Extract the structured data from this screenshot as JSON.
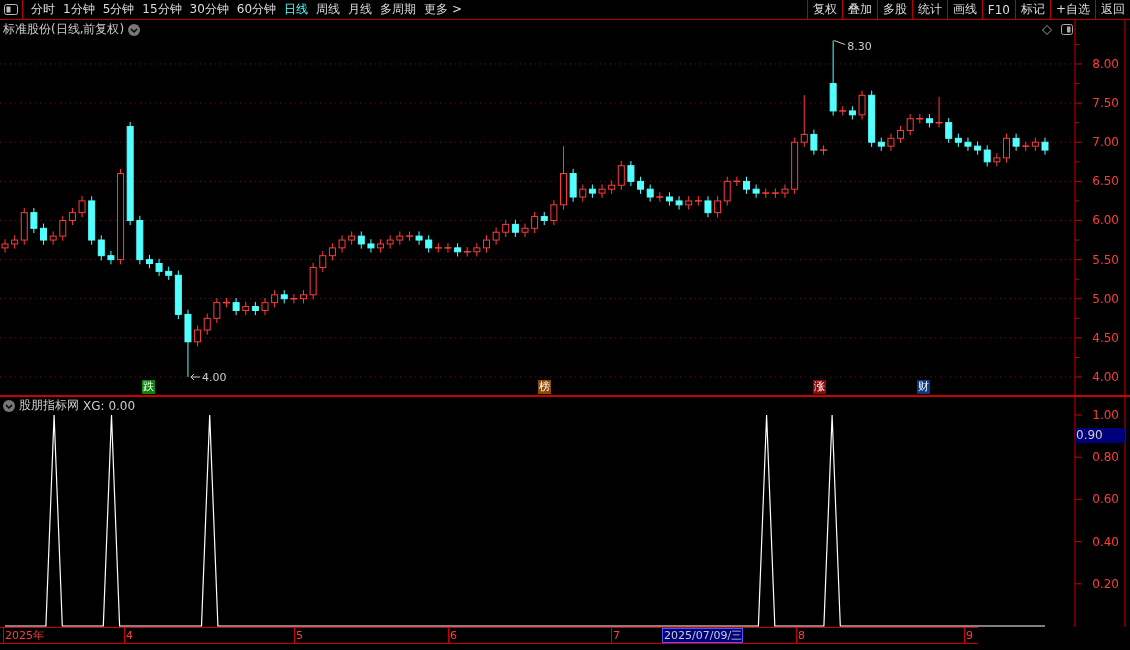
{
  "toolbar": {
    "periods": [
      {
        "label": "分时",
        "selected": false
      },
      {
        "label": "1分钟",
        "selected": false
      },
      {
        "label": "5分钟",
        "selected": false
      },
      {
        "label": "15分钟",
        "selected": false
      },
      {
        "label": "30分钟",
        "selected": false
      },
      {
        "label": "60分钟",
        "selected": false
      },
      {
        "label": "日线",
        "selected": true
      },
      {
        "label": "周线",
        "selected": false
      },
      {
        "label": "月线",
        "selected": false
      },
      {
        "label": "多周期",
        "selected": false
      },
      {
        "label": "更多 >",
        "selected": false
      }
    ],
    "buttons": [
      "复权",
      "叠加",
      "多股",
      "统计",
      "画线",
      "F10",
      "标记",
      "+自选",
      "返回"
    ]
  },
  "main_chart": {
    "title": "标准股份(日线,前复权)",
    "high_label": "8.30",
    "low_label": "4.00",
    "tags": [
      {
        "label": "跌",
        "color": "#0a860a"
      },
      {
        "label": "榜",
        "color": "#8c4a0a"
      },
      {
        "label": "涨",
        "color": "#8a0a0a"
      },
      {
        "label": "财",
        "color": "#0c3a80"
      }
    ],
    "chart_data": {
      "type": "candlestick",
      "ylim": [
        3.757,
        8.562
      ],
      "yticks": [
        {
          "value": 8,
          "label": "8.00"
        },
        {
          "value": 7.5,
          "label": "7.50"
        },
        {
          "value": 7,
          "label": "7.00"
        },
        {
          "value": 6.5,
          "label": "6.50"
        },
        {
          "value": 6,
          "label": "6.00"
        },
        {
          "value": 5.5,
          "label": "5.50"
        },
        {
          "value": 5,
          "label": "5.00"
        },
        {
          "value": 4.5,
          "label": "4.50"
        },
        {
          "value": 4,
          "label": "4.00"
        }
      ],
      "grid": true,
      "ohlc": [
        [
          5.65,
          5.76,
          5.59,
          5.7
        ],
        [
          5.7,
          5.81,
          5.64,
          5.75
        ],
        [
          5.75,
          6.16,
          5.69,
          6.1
        ],
        [
          6.1,
          6.16,
          5.84,
          5.9
        ],
        [
          5.9,
          5.96,
          5.69,
          5.75
        ],
        [
          5.75,
          5.86,
          5.69,
          5.8
        ],
        [
          5.8,
          6.06,
          5.74,
          6.0
        ],
        [
          6.0,
          6.16,
          5.94,
          6.1
        ],
        [
          6.1,
          6.31,
          6.04,
          6.25
        ],
        [
          6.25,
          6.31,
          5.69,
          5.75
        ],
        [
          5.75,
          5.81,
          5.49,
          5.55
        ],
        [
          5.55,
          5.61,
          5.44,
          5.5
        ],
        [
          5.5,
          6.66,
          5.44,
          6.6
        ],
        [
          7.2,
          7.26,
          5.94,
          6.0
        ],
        [
          6.0,
          6.06,
          5.44,
          5.5
        ],
        [
          5.5,
          5.56,
          5.39,
          5.45
        ],
        [
          5.45,
          5.51,
          5.29,
          5.35
        ],
        [
          5.35,
          5.41,
          5.24,
          5.3
        ],
        [
          5.3,
          5.36,
          4.74,
          4.8
        ],
        [
          4.8,
          4.86,
          4.0,
          4.45
        ],
        [
          4.45,
          4.66,
          4.39,
          4.6
        ],
        [
          4.6,
          4.81,
          4.54,
          4.75
        ],
        [
          4.75,
          5.01,
          4.69,
          4.95
        ],
        [
          4.95,
          5.01,
          4.89,
          4.95
        ],
        [
          4.95,
          5.01,
          4.79,
          4.85
        ],
        [
          4.85,
          4.96,
          4.79,
          4.9
        ],
        [
          4.9,
          4.96,
          4.79,
          4.85
        ],
        [
          4.85,
          5.01,
          4.79,
          4.95
        ],
        [
          4.95,
          5.11,
          4.89,
          5.05
        ],
        [
          5.05,
          5.11,
          4.94,
          5.0
        ],
        [
          5.0,
          5.06,
          4.94,
          5.0
        ],
        [
          5.0,
          5.11,
          4.94,
          5.05
        ],
        [
          5.05,
          5.46,
          4.99,
          5.4
        ],
        [
          5.4,
          5.61,
          5.34,
          5.55
        ],
        [
          5.55,
          5.71,
          5.49,
          5.65
        ],
        [
          5.65,
          5.81,
          5.59,
          5.75
        ],
        [
          5.75,
          5.86,
          5.69,
          5.8
        ],
        [
          5.8,
          5.86,
          5.64,
          5.7
        ],
        [
          5.7,
          5.76,
          5.59,
          5.65
        ],
        [
          5.65,
          5.76,
          5.59,
          5.7
        ],
        [
          5.7,
          5.81,
          5.64,
          5.75
        ],
        [
          5.75,
          5.86,
          5.69,
          5.8
        ],
        [
          5.8,
          5.86,
          5.74,
          5.8
        ],
        [
          5.8,
          5.86,
          5.69,
          5.75
        ],
        [
          5.75,
          5.81,
          5.59,
          5.65
        ],
        [
          5.65,
          5.71,
          5.59,
          5.65
        ],
        [
          5.65,
          5.71,
          5.59,
          5.65
        ],
        [
          5.65,
          5.71,
          5.54,
          5.6
        ],
        [
          5.6,
          5.66,
          5.54,
          5.6
        ],
        [
          5.6,
          5.71,
          5.54,
          5.65
        ],
        [
          5.65,
          5.81,
          5.59,
          5.75
        ],
        [
          5.75,
          5.91,
          5.69,
          5.85
        ],
        [
          5.85,
          6.01,
          5.79,
          5.95
        ],
        [
          5.95,
          6.01,
          5.79,
          5.85
        ],
        [
          5.85,
          5.96,
          5.79,
          5.9
        ],
        [
          5.9,
          6.11,
          5.84,
          6.05
        ],
        [
          6.05,
          6.11,
          5.94,
          6.0
        ],
        [
          6.0,
          6.26,
          5.94,
          6.2
        ],
        [
          6.2,
          6.95,
          6.14,
          6.6
        ],
        [
          6.6,
          6.66,
          6.24,
          6.3
        ],
        [
          6.3,
          6.46,
          6.24,
          6.4
        ],
        [
          6.4,
          6.46,
          6.29,
          6.35
        ],
        [
          6.35,
          6.46,
          6.29,
          6.4
        ],
        [
          6.4,
          6.51,
          6.34,
          6.45
        ],
        [
          6.45,
          6.76,
          6.39,
          6.7
        ],
        [
          6.7,
          6.76,
          6.44,
          6.5
        ],
        [
          6.5,
          6.56,
          6.34,
          6.4
        ],
        [
          6.4,
          6.46,
          6.24,
          6.3
        ],
        [
          6.3,
          6.36,
          6.24,
          6.3
        ],
        [
          6.3,
          6.36,
          6.19,
          6.25
        ],
        [
          6.25,
          6.31,
          6.14,
          6.2
        ],
        [
          6.2,
          6.31,
          6.14,
          6.25
        ],
        [
          6.25,
          6.31,
          6.19,
          6.25
        ],
        [
          6.25,
          6.31,
          6.04,
          6.1
        ],
        [
          6.1,
          6.31,
          6.04,
          6.25
        ],
        [
          6.25,
          6.56,
          6.19,
          6.5
        ],
        [
          6.5,
          6.56,
          6.44,
          6.5
        ],
        [
          6.5,
          6.56,
          6.34,
          6.4
        ],
        [
          6.4,
          6.46,
          6.29,
          6.35
        ],
        [
          6.35,
          6.41,
          6.29,
          6.35
        ],
        [
          6.35,
          6.41,
          6.29,
          6.35
        ],
        [
          6.35,
          6.46,
          6.29,
          6.4
        ],
        [
          6.4,
          7.06,
          6.34,
          7.0
        ],
        [
          7.0,
          7.6,
          6.94,
          7.1
        ],
        [
          7.1,
          7.16,
          6.84,
          6.9
        ],
        [
          6.9,
          6.96,
          6.84,
          6.9
        ],
        [
          7.75,
          8.3,
          7.34,
          7.4
        ],
        [
          7.4,
          7.46,
          7.34,
          7.4
        ],
        [
          7.4,
          7.46,
          7.29,
          7.35
        ],
        [
          7.35,
          7.66,
          7.29,
          7.6
        ],
        [
          7.6,
          7.66,
          6.94,
          7.0
        ],
        [
          7.0,
          7.06,
          6.89,
          6.95
        ],
        [
          6.95,
          7.11,
          6.89,
          7.05
        ],
        [
          7.05,
          7.21,
          6.99,
          7.15
        ],
        [
          7.15,
          7.36,
          7.09,
          7.3
        ],
        [
          7.3,
          7.36,
          7.24,
          7.3
        ],
        [
          7.3,
          7.36,
          7.19,
          7.25
        ],
        [
          7.25,
          7.58,
          7.19,
          7.25
        ],
        [
          7.25,
          7.31,
          6.99,
          7.05
        ],
        [
          7.05,
          7.11,
          6.94,
          7.0
        ],
        [
          7.0,
          7.06,
          6.89,
          6.95
        ],
        [
          6.95,
          7.01,
          6.84,
          6.9
        ],
        [
          6.9,
          6.96,
          6.69,
          6.75
        ],
        [
          6.75,
          6.86,
          6.69,
          6.8
        ],
        [
          6.8,
          7.11,
          6.74,
          7.05
        ],
        [
          7.05,
          7.11,
          6.89,
          6.95
        ],
        [
          6.95,
          7.01,
          6.89,
          6.95
        ],
        [
          6.95,
          7.06,
          6.89,
          7.0
        ],
        [
          7.0,
          7.06,
          6.84,
          6.9
        ]
      ]
    }
  },
  "indicator": {
    "title": "股朋指标网",
    "legend": "XG: 0.00",
    "cursor_value": "0.90",
    "chart_data": {
      "type": "line",
      "ylim": [
        0,
        1.09
      ],
      "yticks": [
        {
          "value": 1,
          "label": "1.00"
        },
        {
          "value": 0.8,
          "label": "0.80"
        },
        {
          "value": 0.6,
          "label": "0.60"
        },
        {
          "value": 0.4,
          "label": "0.40"
        },
        {
          "value": 0.2,
          "label": "0.20"
        }
      ],
      "series": [
        {
          "color": "#ffffff",
          "values": [
            0,
            0,
            0,
            0,
            0,
            0,
            1,
            0,
            0,
            0,
            0,
            0,
            0,
            1,
            0,
            0,
            0,
            0,
            0,
            0,
            0,
            0,
            0,
            0,
            0,
            1,
            0,
            0,
            0,
            0,
            0,
            0,
            0,
            0,
            0,
            0,
            0,
            0,
            0,
            0,
            0,
            0,
            0,
            0,
            0,
            0,
            0,
            0,
            0,
            0,
            0,
            0,
            0,
            0,
            0,
            0,
            0,
            0,
            0,
            0,
            0,
            0,
            0,
            0,
            0,
            0,
            0,
            0,
            0,
            0,
            0,
            0,
            0,
            0,
            0,
            0,
            0,
            0,
            0,
            0,
            0,
            0,
            0,
            0,
            0,
            0,
            0,
            0,
            0,
            0,
            0,
            0,
            0,
            1,
            0,
            0,
            0,
            0,
            0,
            0,
            0,
            1,
            0,
            0,
            0,
            0,
            0,
            0,
            0,
            0,
            0,
            0,
            0,
            0,
            0,
            0,
            0,
            0,
            0,
            0,
            0,
            0,
            0,
            0,
            0,
            0,
            0,
            0
          ]
        }
      ]
    }
  },
  "date_axis": [
    {
      "label": "2025年",
      "selected": false
    },
    {
      "label": "4",
      "selected": false
    },
    {
      "label": "5",
      "selected": false
    },
    {
      "label": "6",
      "selected": false
    },
    {
      "label": "7",
      "selected": false
    },
    {
      "label": "2025/07/09/三",
      "selected": true
    },
    {
      "label": "8",
      "selected": false
    },
    {
      "label": "9",
      "selected": false
    }
  ]
}
